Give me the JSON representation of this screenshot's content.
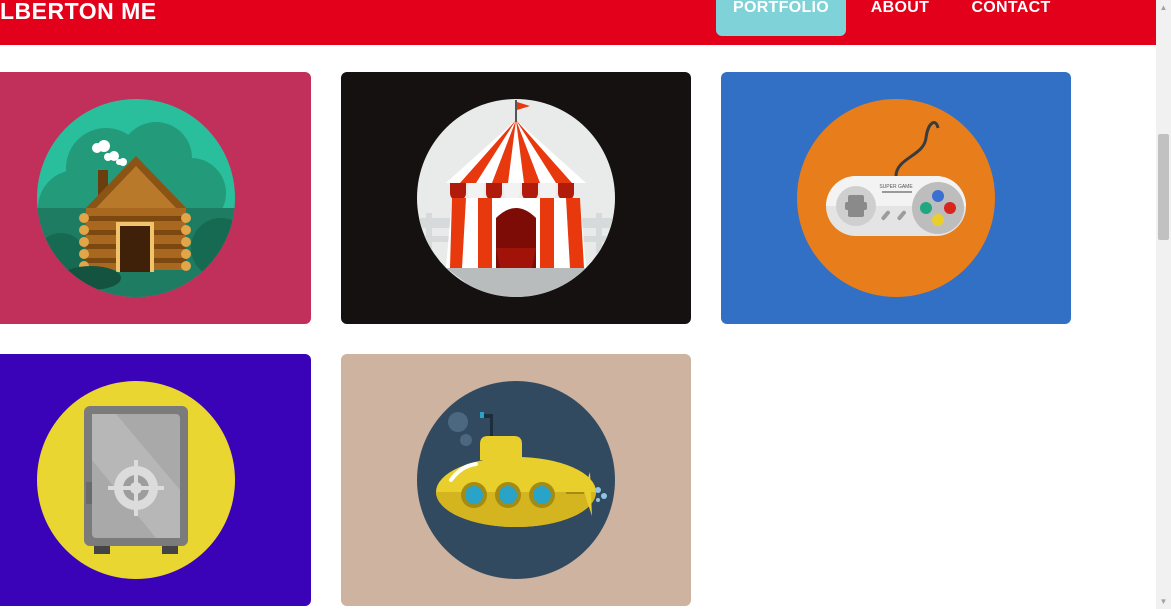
{
  "nav": {
    "brand": "LBERTON ME",
    "links": [
      {
        "label": "PORTFOLIO",
        "active": true
      },
      {
        "label": "ABOUT",
        "active": false
      },
      {
        "label": "CONTACT",
        "active": false
      }
    ]
  },
  "colors": {
    "navbar": "#e2001a",
    "active_tab": "#7fd3d8"
  },
  "portfolio": {
    "items": [
      {
        "icon": "log-cabin-icon",
        "bg": "#c1305a"
      },
      {
        "icon": "circus-tent-icon",
        "bg": "#141110"
      },
      {
        "icon": "game-controller-icon",
        "bg": "#3170c5",
        "label": "SUPER GAME"
      },
      {
        "icon": "safe-icon",
        "bg": "#3a03b8"
      },
      {
        "icon": "submarine-icon",
        "bg": "#cdb3a0"
      }
    ]
  }
}
